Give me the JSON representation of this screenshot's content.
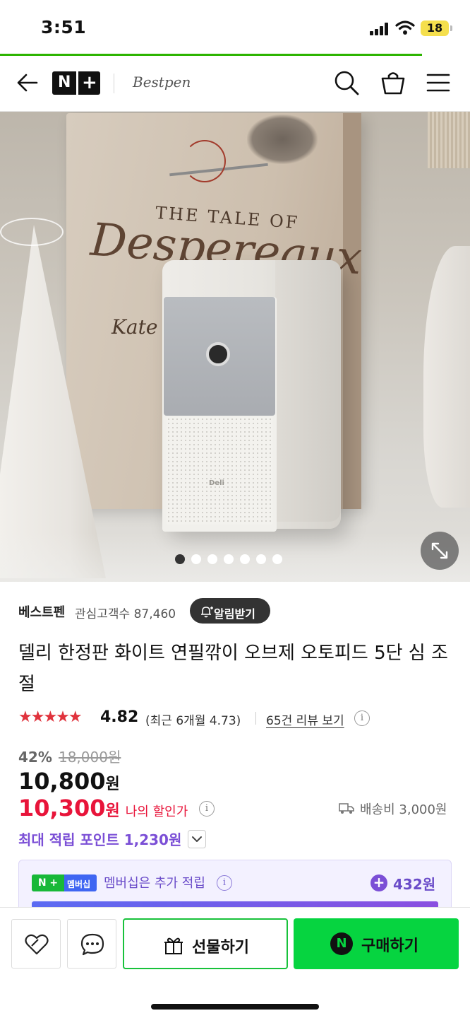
{
  "status_bar": {
    "time": "3:51",
    "battery": "18"
  },
  "header": {
    "logo_text": "N",
    "brand": "Bestpen"
  },
  "hero": {
    "book_line1": "THE TALE OF",
    "book_line2": "Despereaux",
    "book_line3": "Kate",
    "device_label": "Deli",
    "carousel_count": 7,
    "carousel_active": 1
  },
  "seller": {
    "name": "베스트펜",
    "followers": "관심고객수 87,460",
    "alarm_label": "알림받기"
  },
  "product": {
    "title": "델리 한정판 화이트 연필깎이 오브제 오토피드 5단 심 조절",
    "rating_stars": "★★★★★",
    "rating": "4.82",
    "recent_rating": "(최근 6개월 4.73)",
    "review_link": "65건 리뷰 보기",
    "discount": "42%",
    "original_price": "18,000원",
    "price": "10,800",
    "price_unit": "원",
    "my_price": "10,300",
    "my_price_unit": "원",
    "my_price_label": "나의 할인가",
    "shipping": "배송비 3,000원",
    "points": "최대 적립 포인트 1,230원"
  },
  "membership": {
    "badge_np": "N +",
    "badge_text": "멤버십",
    "text": "멤버십은 추가 적립",
    "points": "432원"
  },
  "actions": {
    "gift_label": "선물하기",
    "buy_label": "구매하기",
    "buy_icon": "N"
  },
  "colors": {
    "naver_green": "#06d440",
    "price_red": "#e8143a",
    "points_purple": "#7b4fd6"
  }
}
